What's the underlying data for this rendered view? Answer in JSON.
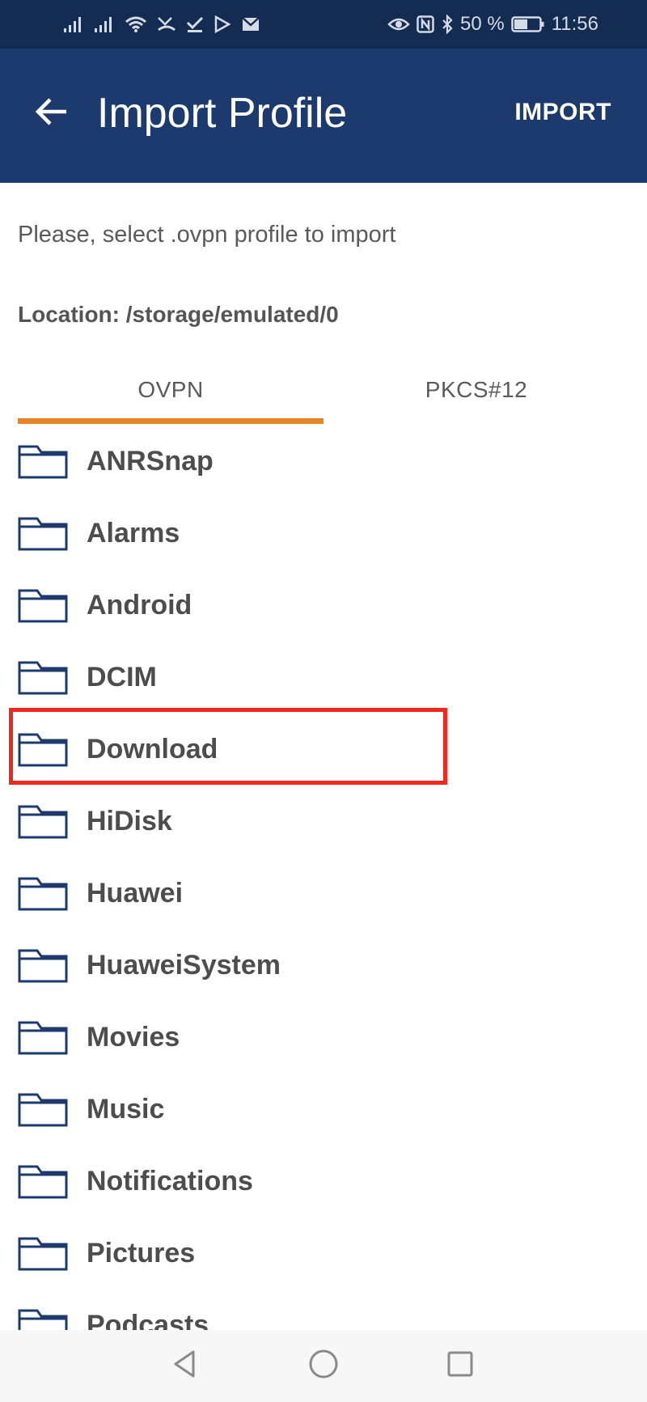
{
  "status_bar": {
    "battery_text": "50 %",
    "time": "11:56",
    "icons": [
      "signal-icon",
      "signal-icon",
      "wifi-icon",
      "missed-call-icon",
      "check-icon",
      "play-store-icon",
      "mail-icon",
      "eye-icon",
      "nfc-icon",
      "bluetooth-icon",
      "battery-icon"
    ]
  },
  "app_bar": {
    "title": "Import Profile",
    "action_label": "IMPORT",
    "color": "#1c3a6e"
  },
  "instruction": "Please, select .ovpn profile to import",
  "location": "Location: /storage/emulated/0",
  "tabs": [
    {
      "label": "OVPN",
      "selected": true
    },
    {
      "label": "PKCS#12",
      "selected": false
    }
  ],
  "accent_color": "#e98426",
  "folders": [
    {
      "label": "ANRSnap"
    },
    {
      "label": "Alarms"
    },
    {
      "label": "Android"
    },
    {
      "label": "DCIM"
    },
    {
      "label": "Download",
      "highlighted": true
    },
    {
      "label": "HiDisk"
    },
    {
      "label": "Huawei"
    },
    {
      "label": "HuaweiSystem"
    },
    {
      "label": "Movies"
    },
    {
      "label": "Music"
    },
    {
      "label": "Notifications"
    },
    {
      "label": "Pictures"
    },
    {
      "label": "Podcasts"
    }
  ],
  "highlight_color": "#ef2a1d",
  "nav_bar": {
    "buttons": [
      "back-triangle-icon",
      "home-circle-icon",
      "recents-square-icon"
    ]
  }
}
